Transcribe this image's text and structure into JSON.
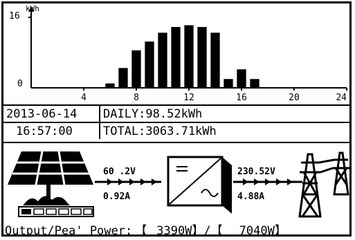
{
  "chart_data": {
    "type": "bar",
    "ylabel": "kWh",
    "y_ticks": [
      "16",
      "0"
    ],
    "x_ticks": [
      "4",
      "8",
      "12",
      "16",
      "20",
      "24"
    ],
    "x": [
      6,
      7,
      8,
      9,
      10,
      11,
      12,
      13,
      14,
      15,
      16,
      17
    ],
    "values": [
      1,
      4.5,
      8.5,
      10.5,
      12.5,
      13.8,
      14.2,
      13.8,
      12.5,
      2,
      4.2,
      2
    ],
    "xlim": [
      0,
      24
    ],
    "ylim": [
      0,
      16
    ]
  },
  "info": {
    "date": "2013-06-14",
    "time": "16:57:00",
    "daily": "DAILY:98.52kWh",
    "total": "TOTAL:3063.71kWh"
  },
  "pv": {
    "voltage": "60 .2V",
    "current": "0.92A"
  },
  "grid": {
    "voltage": "230.52V",
    "current": "4.88A"
  },
  "bottom": {
    "label": "Output/Pea' Power:",
    "open1": "【",
    "output": "3390W",
    "sep": "】/【",
    "peak": "7040W",
    "close2": "】"
  }
}
